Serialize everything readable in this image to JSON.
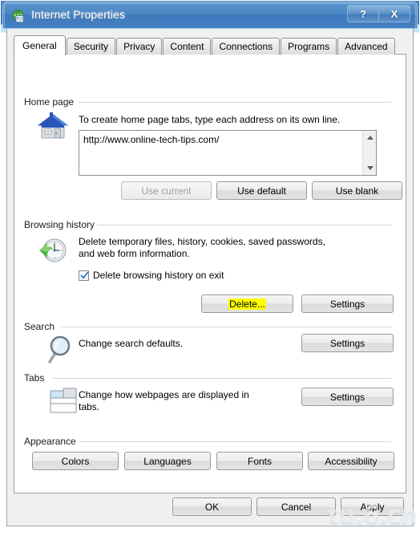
{
  "window": {
    "title": "Internet Properties",
    "icon": "internet-options-globe-icon",
    "help_button": "?",
    "close_button": "X",
    "watermark": "tu.6.cn",
    "titlebar_color": "#3d79bd",
    "frame_glow_color": "#6fd8f5"
  },
  "tabs": [
    {
      "label": "General",
      "active": true
    },
    {
      "label": "Security",
      "active": false
    },
    {
      "label": "Privacy",
      "active": false
    },
    {
      "label": "Content",
      "active": false
    },
    {
      "label": "Connections",
      "active": false
    },
    {
      "label": "Programs",
      "active": false
    },
    {
      "label": "Advanced",
      "active": false
    }
  ],
  "home_page": {
    "group_label": "Home page",
    "icon": "house-icon",
    "description": "To create home page tabs, type each address on its own line.",
    "url_value": "http://www.online-tech-tips.com/",
    "buttons": {
      "use_current": "Use current",
      "use_default": "Use default",
      "use_blank": "Use blank"
    }
  },
  "browsing_history": {
    "group_label": "Browsing history",
    "icon": "clock-history-icon",
    "description_line1": "Delete temporary files, history, cookies, saved passwords,",
    "description_line2": "and web form information.",
    "checkbox_label": "Delete browsing history on exit",
    "checkbox_checked": true,
    "buttons": {
      "delete": "Delete...",
      "settings": "Settings"
    },
    "highlight_color": "#ffff00"
  },
  "search": {
    "group_label": "Search",
    "icon": "magnifier-icon",
    "description": "Change search defaults.",
    "buttons": {
      "settings": "Settings"
    }
  },
  "tabs_section": {
    "group_label": "Tabs",
    "icon": "browser-tabs-icon",
    "description_line1": "Change how webpages are displayed in",
    "description_line2": "tabs.",
    "buttons": {
      "settings": "Settings"
    }
  },
  "appearance": {
    "group_label": "Appearance",
    "buttons": {
      "colors": "Colors",
      "languages": "Languages",
      "fonts": "Fonts",
      "accessibility": "Accessibility"
    }
  },
  "dialog_buttons": {
    "ok": "OK",
    "cancel": "Cancel",
    "apply": "Apply"
  }
}
